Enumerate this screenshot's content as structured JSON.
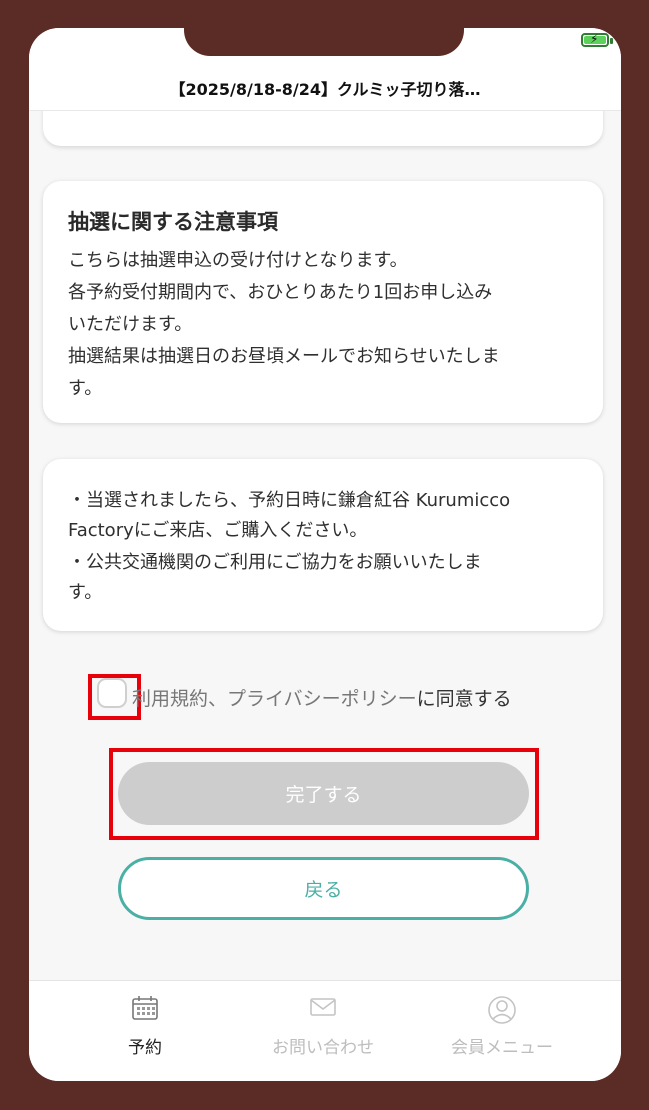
{
  "header": {
    "title": "【2025/8/18-8/24】クルミッ子切り落…"
  },
  "notice": {
    "title": "抽選に関する注意事項",
    "lines": [
      "こちらは抽選申込の受け付けとなります。",
      "各予約受付期間内で、おひとりあたり1回お申し込み",
      "いただけます。",
      "抽選結果は抽選日のお昼頃メールでお知らせいたしま",
      "す。"
    ]
  },
  "info": {
    "lines": [
      "・当選されましたら、予約日時に鎌倉紅谷 Kurumicco",
      "Factoryにご来店、ご購入ください。",
      "・公共交通機関のご利用にご協力をお願いいたしま",
      "す。"
    ]
  },
  "agreement": {
    "link_text": "利用規約、プライバシーポリシー",
    "suffix": "に同意する"
  },
  "buttons": {
    "complete": "完了する",
    "back": "戻る"
  },
  "tabs": [
    {
      "label": "予約",
      "icon": "calendar-icon",
      "active": true
    },
    {
      "label": "お問い合わせ",
      "icon": "mail-icon",
      "active": false
    },
    {
      "label": "会員メニュー",
      "icon": "user-icon",
      "active": false
    }
  ],
  "colors": {
    "frame": "#5b2b25",
    "accent": "#4ab0a5",
    "highlight": "#e8000b",
    "disabled": "#cdcdcd"
  }
}
